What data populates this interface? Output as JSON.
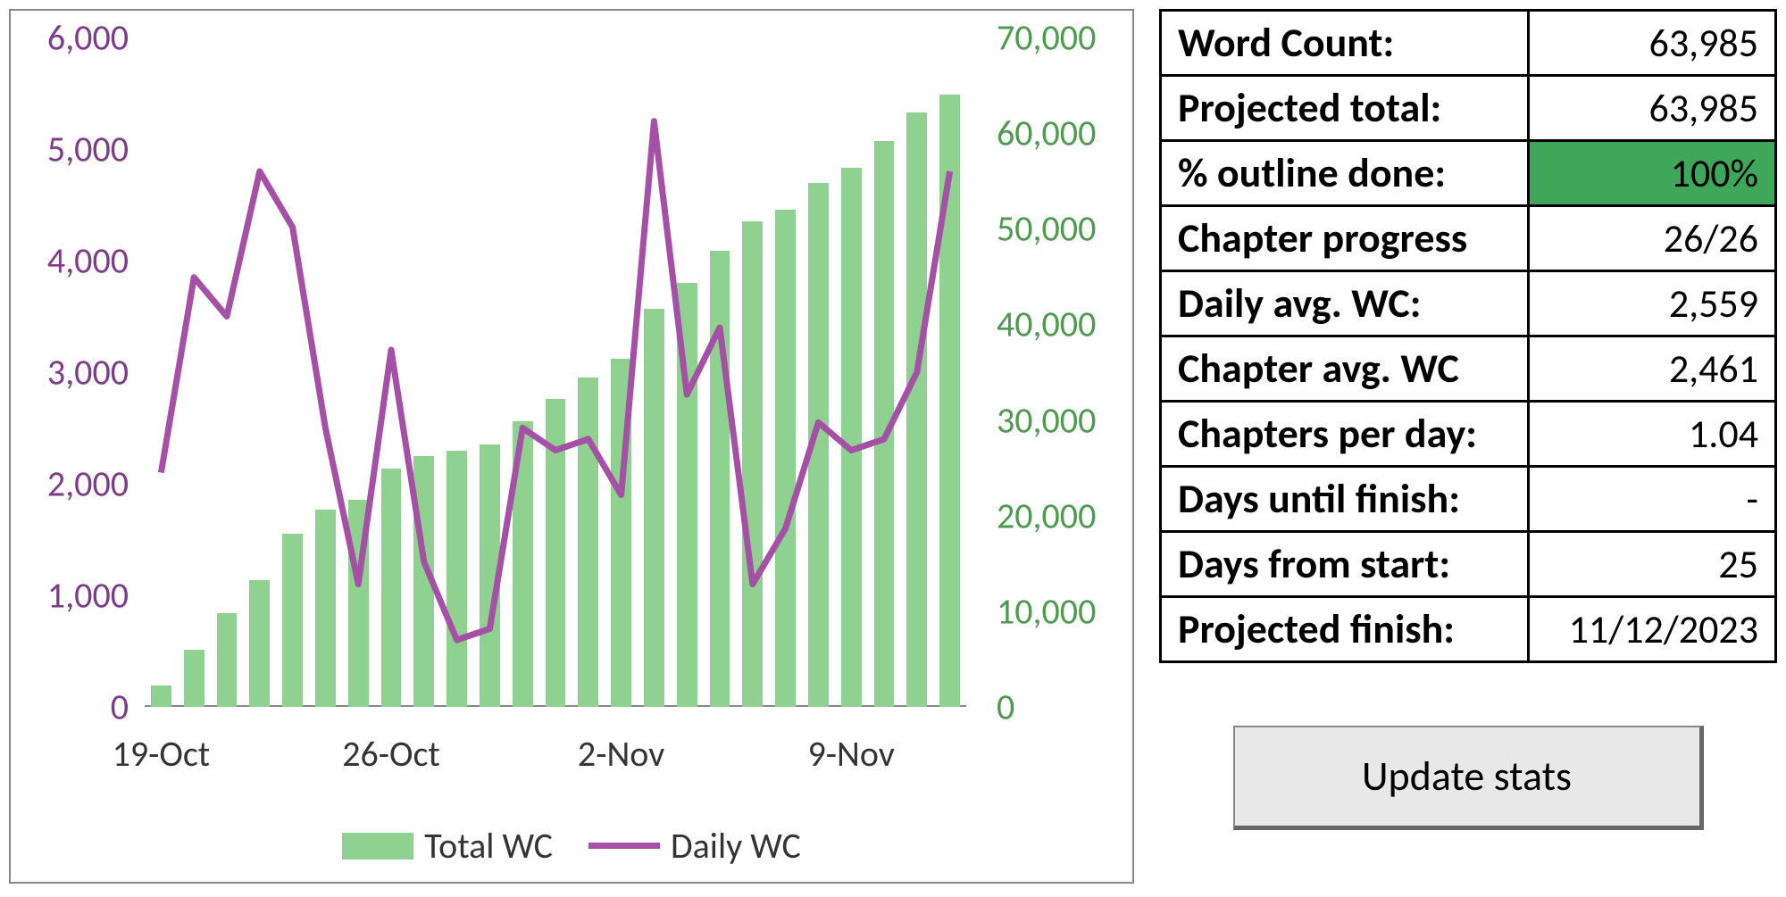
{
  "chart_data": {
    "type": "combo",
    "x": [
      "19-Oct",
      "20-Oct",
      "21-Oct",
      "22-Oct",
      "23-Oct",
      "24-Oct",
      "25-Oct",
      "26-Oct",
      "27-Oct",
      "28-Oct",
      "29-Oct",
      "30-Oct",
      "31-Oct",
      "1-Nov",
      "2-Nov",
      "3-Nov",
      "4-Nov",
      "5-Nov",
      "6-Nov",
      "7-Nov",
      "8-Nov",
      "9-Nov",
      "10-Nov",
      "11-Nov",
      "12-Nov"
    ],
    "series": [
      {
        "name": "Total WC",
        "type": "bar",
        "axis": "right",
        "values": [
          2200,
          6000,
          9800,
          13300,
          18100,
          20600,
          21700,
          24900,
          26200,
          26800,
          27400,
          29900,
          32200,
          34400,
          36400,
          41600,
          44300,
          47700,
          50800,
          52000,
          54800,
          56400,
          59200,
          62200,
          63985
        ]
      },
      {
        "name": "Daily WC",
        "type": "line",
        "axis": "left",
        "values": [
          2100,
          3850,
          3500,
          4800,
          4300,
          2500,
          1100,
          3200,
          1300,
          600,
          700,
          2500,
          2300,
          2400,
          1900,
          5250,
          2800,
          3400,
          1100,
          1600,
          2550,
          2300,
          2400,
          3000,
          4800
        ]
      }
    ],
    "left_axis": {
      "min": 0,
      "max": 6000,
      "ticks": [
        0,
        1000,
        2000,
        3000,
        4000,
        5000,
        6000
      ],
      "color": "#7e3b8a"
    },
    "right_axis": {
      "min": 0,
      "max": 70000,
      "ticks": [
        0,
        10000,
        20000,
        30000,
        40000,
        50000,
        60000,
        70000
      ],
      "color": "#4e9a4e"
    },
    "x_ticks": [
      "19-Oct",
      "26-Oct",
      "2-Nov",
      "9-Nov"
    ],
    "legend": [
      "Total WC",
      "Daily WC"
    ]
  },
  "stats": {
    "rows": [
      {
        "label": "Word Count:",
        "value": "63,985",
        "green": false
      },
      {
        "label": "Projected total:",
        "value": "63,985",
        "green": false
      },
      {
        "label": "% outline done:",
        "value": "100%",
        "green": true
      },
      {
        "label": "Chapter progress",
        "value": "26/26",
        "green": false
      },
      {
        "label": "Daily avg. WC:",
        "value": "2,559",
        "green": false
      },
      {
        "label": "Chapter avg. WC",
        "value": "2,461",
        "green": false
      },
      {
        "label": "Chapters per day:",
        "value": "1.04",
        "green": false
      },
      {
        "label": "Days until finish:",
        "value": "-",
        "green": false
      },
      {
        "label": "Days from start:",
        "value": "25",
        "green": false
      },
      {
        "label": "Projected finish:",
        "value": "11/12/2023",
        "green": false
      }
    ]
  },
  "button": {
    "label": "Update stats"
  }
}
